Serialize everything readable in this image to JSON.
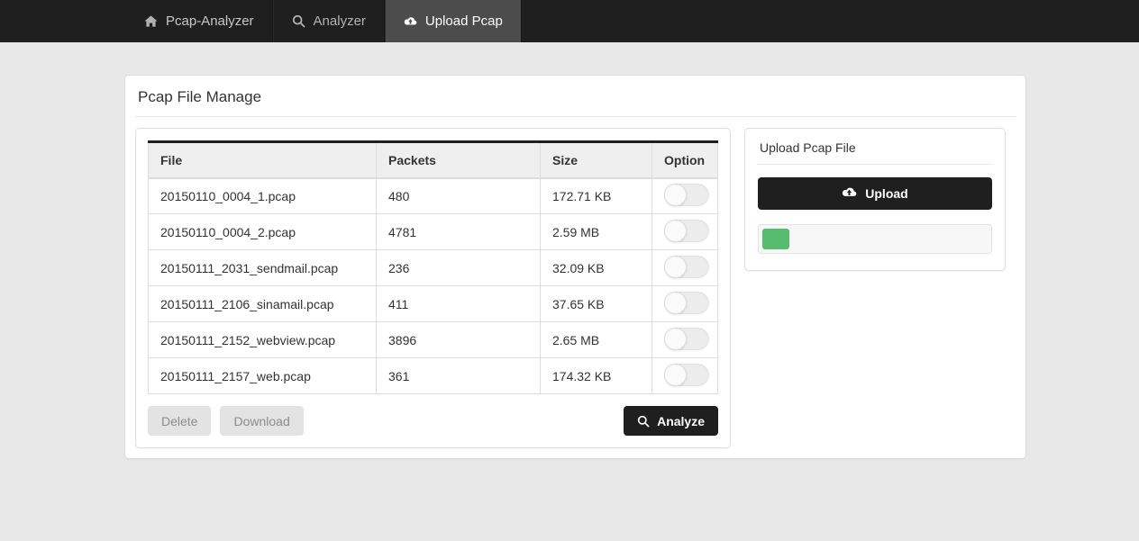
{
  "navbar": {
    "items": [
      {
        "label": "Pcap-Analyzer",
        "icon": "home-icon",
        "active": false
      },
      {
        "label": "Analyzer",
        "icon": "search-icon",
        "active": false
      },
      {
        "label": "Upload Pcap",
        "icon": "cloud-upload-icon",
        "active": true
      }
    ]
  },
  "panel": {
    "title": "Pcap File Manage"
  },
  "table": {
    "columns": [
      "File",
      "Packets",
      "Size",
      "Option"
    ],
    "rows": [
      {
        "file": "20150110_0004_1.pcap",
        "packets": "480",
        "size": "172.71 KB",
        "toggle": "off"
      },
      {
        "file": "20150110_0004_2.pcap",
        "packets": "4781",
        "size": "2.59 MB",
        "toggle": "off"
      },
      {
        "file": "20150111_2031_sendmail.pcap",
        "packets": "236",
        "size": "32.09 KB",
        "toggle": "off"
      },
      {
        "file": "20150111_2106_sinamail.pcap",
        "packets": "411",
        "size": "37.65 KB",
        "toggle": "off"
      },
      {
        "file": "20150111_2152_webview.pcap",
        "packets": "3896",
        "size": "2.65 MB",
        "toggle": "off"
      },
      {
        "file": "20150111_2157_web.pcap",
        "packets": "361",
        "size": "174.32 KB",
        "toggle": "off"
      }
    ]
  },
  "actions": {
    "delete_label": "Delete",
    "download_label": "Download",
    "analyze_label": "Analyze",
    "analyze_icon": "search-icon"
  },
  "upload": {
    "title": "Upload Pcap File",
    "button_label": "Upload",
    "button_icon": "cloud-upload-icon",
    "progress_percent": 12
  },
  "colors": {
    "navbar_bg": "#1f1f1f",
    "navbar_active_bg": "#4c4c4c",
    "page_bg": "#e8e8e8",
    "accent_dark": "#1f1f1f",
    "progress_green": "#57bc6e",
    "table_header_bg": "#efefef",
    "border": "#dddddd"
  }
}
